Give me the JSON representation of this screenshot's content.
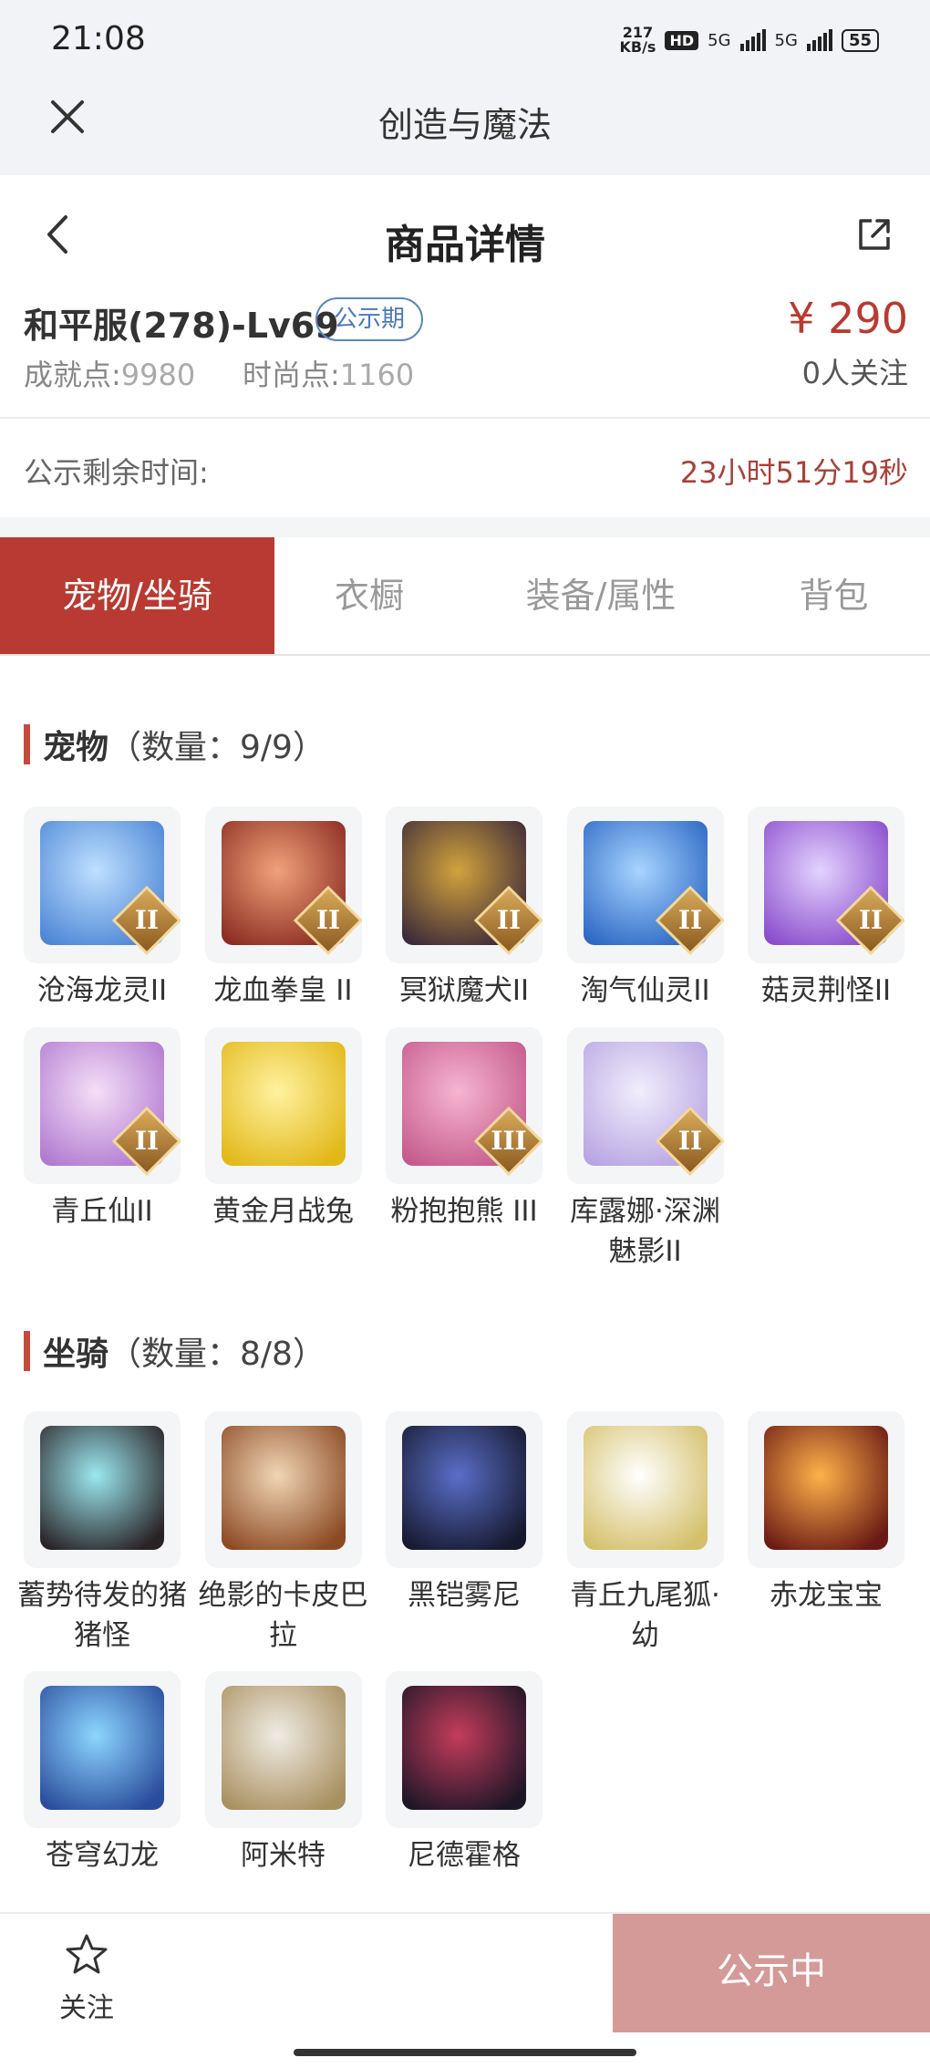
{
  "status": {
    "time": "21:08",
    "speed_top": "217",
    "speed_bottom": "KB/s",
    "hd": "HD",
    "net1": "5G",
    "net2": "5G",
    "battery": "55"
  },
  "appbar": {
    "title": "创造与魔法"
  },
  "navbar": {
    "title": "商品详情"
  },
  "product": {
    "name": "和平服(278)-Lv69",
    "badge": "公示期",
    "price": "¥ 290",
    "achievement_label": "成就点:",
    "achievement_value": "9980",
    "fashion_label": "时尚点:",
    "fashion_value": "1160",
    "followers": "0人关注"
  },
  "countdown": {
    "label": "公示剩余时间:",
    "value": "23小时51分19秒"
  },
  "tabs": [
    "宠物/坐骑",
    "衣橱",
    "装备/属性",
    "背包"
  ],
  "pets": {
    "title": "宠物",
    "count": "（数量：9/9）",
    "items": [
      {
        "name": "沧海龙灵II",
        "tier": "II",
        "colors": [
          "#bfe0ff",
          "#4d86d6"
        ]
      },
      {
        "name": "龙血拳皇 II",
        "tier": "II",
        "colors": [
          "#f0a27a",
          "#8c2c22"
        ]
      },
      {
        "name": "冥狱魔犬II",
        "tier": "II",
        "colors": [
          "#d2a33c",
          "#3c2a3a"
        ]
      },
      {
        "name": "淘气仙灵II",
        "tier": "II",
        "colors": [
          "#a8d4ff",
          "#2c68c4"
        ]
      },
      {
        "name": "菇灵荆怪II",
        "tier": "II",
        "colors": [
          "#e3d3ff",
          "#8a4ccc"
        ]
      },
      {
        "name": "青丘仙II",
        "tier": "II",
        "colors": [
          "#f5dff7",
          "#b07ad0"
        ]
      },
      {
        "name": "黄金月战兔",
        "tier": "",
        "colors": [
          "#fff2a0",
          "#e2b818"
        ]
      },
      {
        "name": "粉抱抱熊 III",
        "tier": "III",
        "colors": [
          "#f6b5d0",
          "#c45a8c"
        ]
      },
      {
        "name": "库露娜·深渊魅影II",
        "tier": "II",
        "colors": [
          "#f1eefc",
          "#b7a5e2"
        ]
      }
    ]
  },
  "mounts": {
    "title": "坐骑",
    "count": "（数量：8/8）",
    "items": [
      {
        "name": "蓄势待发的猪猪怪",
        "colors": [
          "#9be8f0",
          "#2a2326"
        ]
      },
      {
        "name": "绝影的卡皮巴拉",
        "colors": [
          "#f0d6b5",
          "#8c4a24"
        ]
      },
      {
        "name": "黑铠雾尼",
        "colors": [
          "#5a6ec8",
          "#16192e"
        ]
      },
      {
        "name": "青丘九尾狐·幼",
        "colors": [
          "#ffffff",
          "#d4c06a"
        ]
      },
      {
        "name": "赤龙宝宝",
        "colors": [
          "#ffb24a",
          "#6a1a14"
        ]
      },
      {
        "name": "苍穹幻龙",
        "colors": [
          "#8cd6ff",
          "#2a4c9c"
        ]
      },
      {
        "name": "阿米特",
        "colors": [
          "#f0ece4",
          "#a89060"
        ]
      },
      {
        "name": "尼德霍格",
        "colors": [
          "#c43c5c",
          "#1c1626"
        ]
      }
    ]
  },
  "bottom": {
    "follow_label": "关注",
    "cta_label": "公示中"
  }
}
